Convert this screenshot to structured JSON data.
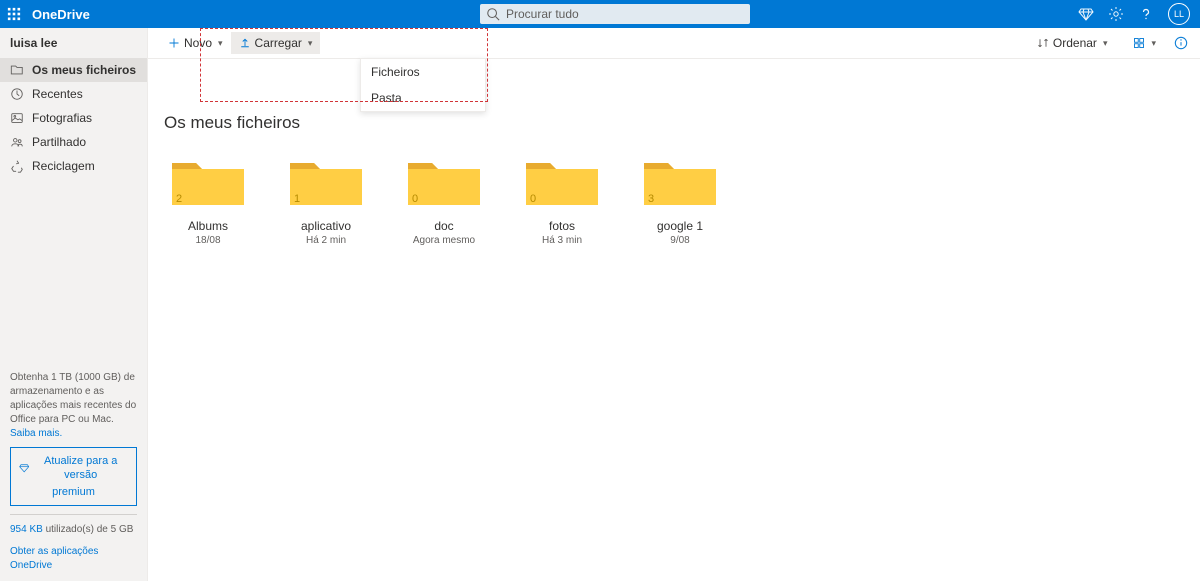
{
  "app_name": "OneDrive",
  "search_placeholder": "Procurar tudo",
  "avatar_initials": "LL",
  "user_name": "luisa lee",
  "sidebar": {
    "items": [
      {
        "label": "Os meus ficheiros",
        "icon": "folder"
      },
      {
        "label": "Recentes",
        "icon": "clock"
      },
      {
        "label": "Fotografias",
        "icon": "photo"
      },
      {
        "label": "Partilhado",
        "icon": "people"
      },
      {
        "label": "Reciclagem",
        "icon": "recycle"
      }
    ],
    "promo_text": "Obtenha 1 TB (1000 GB) de armazenamento e as aplicações mais recentes do Office para PC ou Mac.",
    "learn_more": "Saiba mais.",
    "premium_line1": "Atualize para a versão",
    "premium_line2": "premium",
    "storage_used": "954 KB",
    "storage_rest": " utilizado(s) de 5 GB",
    "get_apps": "Obter as aplicações OneDrive"
  },
  "toolbar": {
    "new_label": "Novo",
    "upload_label": "Carregar",
    "sort_label": "Ordenar",
    "dropdown": {
      "files": "Ficheiros",
      "folder": "Pasta"
    }
  },
  "page_title": "Os meus ficheiros",
  "folders": [
    {
      "name": "Albums",
      "date": "18/08",
      "count": "2"
    },
    {
      "name": "aplicativo",
      "date": "Há 2 min",
      "count": "1"
    },
    {
      "name": "doc",
      "date": "Agora mesmo",
      "count": "0"
    },
    {
      "name": "fotos",
      "date": "Há 3 min",
      "count": "0"
    },
    {
      "name": "google 1",
      "date": "9/08",
      "count": "3"
    }
  ]
}
